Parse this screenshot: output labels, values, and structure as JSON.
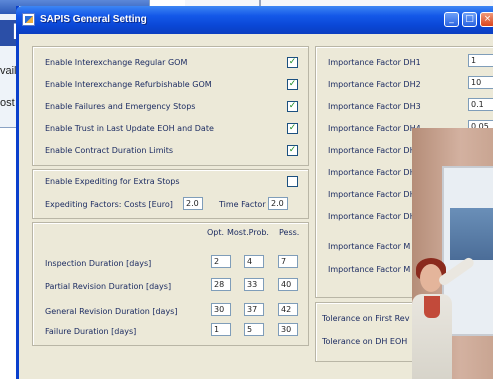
{
  "background_window": {
    "big_text": "lı",
    "fragment_1": "vail",
    "fragment_2": "ost"
  },
  "dialog": {
    "title": "SAPIS General Setting",
    "buttons": {
      "minimize": "_",
      "maximize": "□",
      "close": "×"
    }
  },
  "checks": [
    {
      "label": "Enable Interexchange Regular GOM",
      "checked": true
    },
    {
      "label": "Enable Interexchange Refurbishable GOM",
      "checked": true
    },
    {
      "label": "Enable Failures and Emergency Stops",
      "checked": true
    },
    {
      "label": "Enable Trust in Last Update EOH and Date",
      "checked": true
    },
    {
      "label": "Enable Contract Duration Limits",
      "checked": true
    }
  ],
  "expediting": {
    "enable_label": "Enable Expediting for Extra Stops",
    "enable_checked": false,
    "costs_label": "Expediting Factors: Costs [Euro]",
    "costs_value": "2.0",
    "time_label": "Time Factor",
    "time_value": "2.0"
  },
  "durations": {
    "headers": [
      "Opt.",
      "Most.Prob.",
      "Pess."
    ],
    "rows": [
      {
        "label": "Inspection Duration [days]",
        "opt": "2",
        "most": "4",
        "pess": "7"
      },
      {
        "label": "Partial Revision Duration [days]",
        "opt": "28",
        "most": "33",
        "pess": "40"
      },
      {
        "label": "General Revision Duration [days]",
        "opt": "30",
        "most": "37",
        "pess": "42"
      },
      {
        "label": "Failure Duration [days]",
        "opt": "1",
        "most": "5",
        "pess": "30"
      }
    ]
  },
  "importance": [
    {
      "label": "Importance Factor DH1",
      "value": "1"
    },
    {
      "label": "Importance Factor DH2",
      "value": "10"
    },
    {
      "label": "Importance Factor DH3",
      "value": "0.1"
    },
    {
      "label": "Importance Factor DH4",
      "value": "0.05"
    },
    {
      "label": "Importance Factor DH",
      "value": ""
    },
    {
      "label": "Importance Factor DH",
      "value": ""
    },
    {
      "label": "Importance Factor DH",
      "value": ""
    },
    {
      "label": "Importance Factor DH",
      "value": ""
    },
    {
      "label": "Importance Factor M",
      "value": ""
    },
    {
      "label": "Importance Factor M",
      "value": ""
    }
  ],
  "tolerance": {
    "first": "Tolerance on First Rev",
    "second": "Tolerance on DH EOH"
  }
}
